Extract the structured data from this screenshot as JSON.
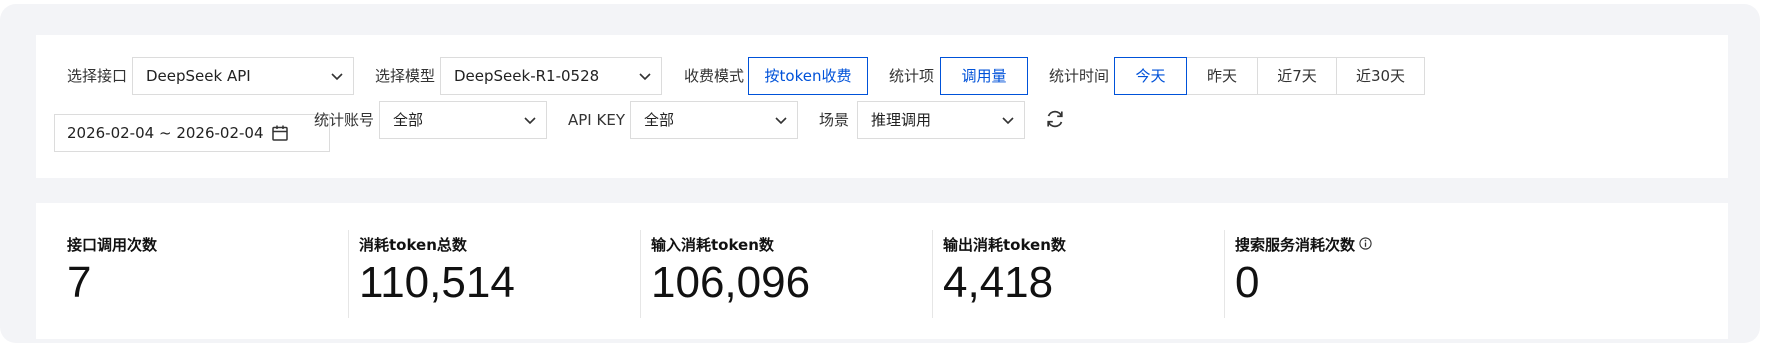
{
  "filters": {
    "interface": {
      "label": "选择接口",
      "value": "DeepSeek API"
    },
    "model": {
      "label": "选择模型",
      "value": "DeepSeek-R1-0528"
    },
    "billing_mode": {
      "label": "收费模式",
      "value": "按token收费"
    },
    "stat_item": {
      "label": "统计项",
      "value": "调用量"
    },
    "stat_time": {
      "label": "统计时间",
      "options": [
        "今天",
        "昨天",
        "近7天",
        "近30天"
      ],
      "selected": "今天"
    },
    "date_range": {
      "start": "2026-02-04",
      "end": "~ 2026-02-04"
    },
    "account": {
      "label": "统计账号",
      "value": "全部"
    },
    "api_key": {
      "label": "API KEY",
      "value": "全部"
    },
    "scene": {
      "label": "场景",
      "value": "推理调用"
    }
  },
  "stats": [
    {
      "label": "接口调用次数",
      "value": "7"
    },
    {
      "label": "消耗token总数",
      "value": "110,514"
    },
    {
      "label": "输入消耗token数",
      "value": "106,096"
    },
    {
      "label": "输出消耗token数",
      "value": "4,418"
    },
    {
      "label": "搜索服务消耗次数",
      "value": "0"
    }
  ],
  "icons": {
    "dropdown": "chevron-down-icon",
    "calendar": "calendar-icon",
    "refresh": "refresh-icon",
    "info": "info-icon"
  },
  "colors": {
    "accent": "#0052d9",
    "background": "#f3f4f7"
  }
}
